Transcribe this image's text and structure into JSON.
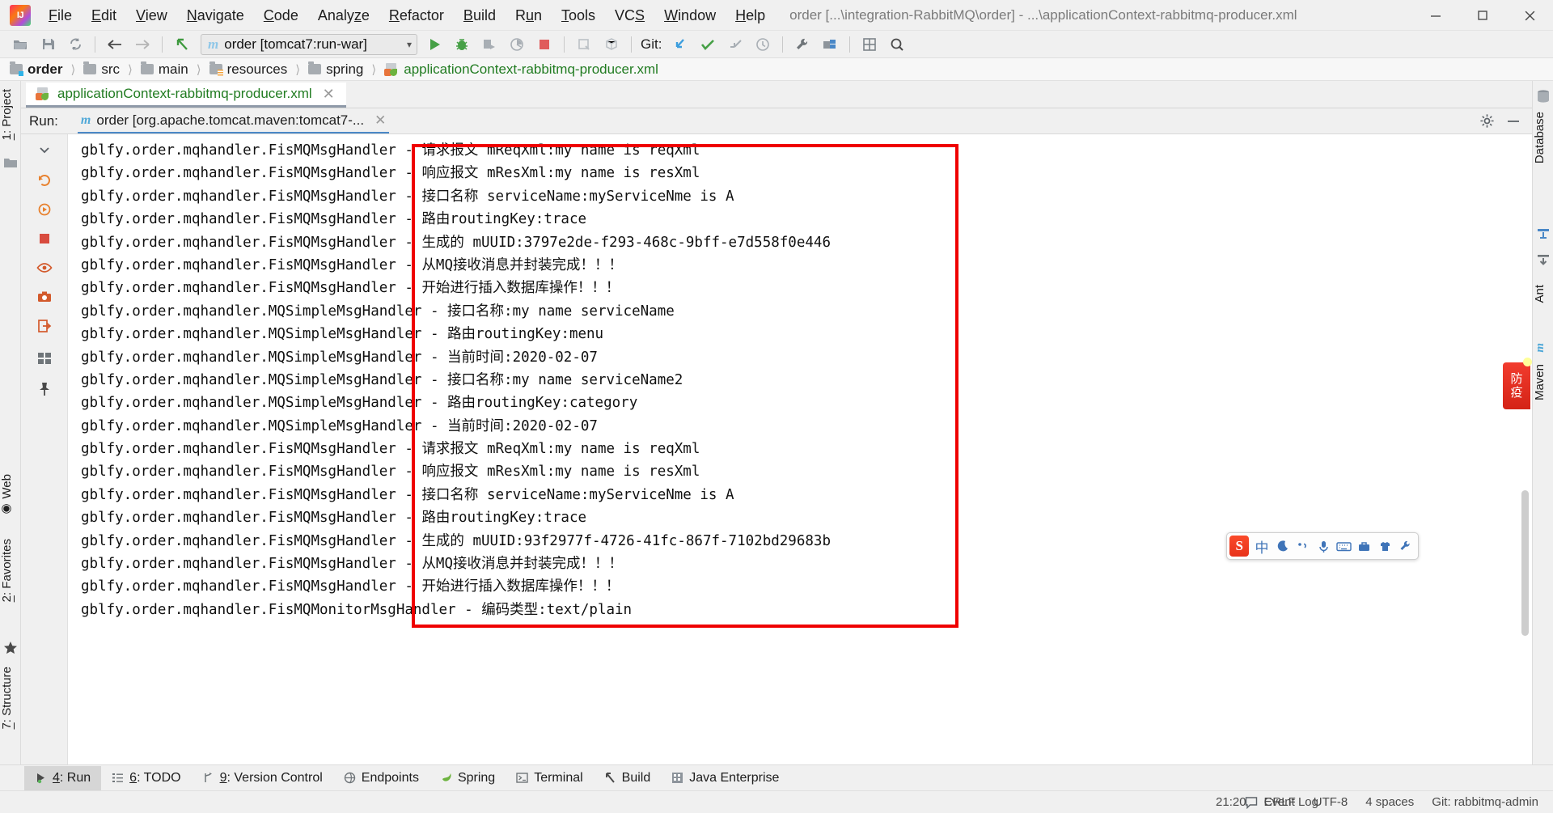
{
  "window": {
    "title": "order [...\\integration-RabbitMQ\\order] - ...\\applicationContext-rabbitmq-producer.xml",
    "app_icon": "intellij-idea-logo",
    "minimize": "—",
    "maximize": "☐",
    "close": "✕"
  },
  "menubar": {
    "items": [
      {
        "label": "File",
        "mnemonic": "F"
      },
      {
        "label": "Edit",
        "mnemonic": "E"
      },
      {
        "label": "View",
        "mnemonic": "V"
      },
      {
        "label": "Navigate",
        "mnemonic": "N"
      },
      {
        "label": "Code",
        "mnemonic": "C"
      },
      {
        "label": "Analyze",
        "mnemonic": "z"
      },
      {
        "label": "Refactor",
        "mnemonic": "R"
      },
      {
        "label": "Build",
        "mnemonic": "B"
      },
      {
        "label": "Run",
        "mnemonic": "u"
      },
      {
        "label": "Tools",
        "mnemonic": "T"
      },
      {
        "label": "VCS",
        "mnemonic": "S"
      },
      {
        "label": "Window",
        "mnemonic": "W"
      },
      {
        "label": "Help",
        "mnemonic": "H"
      }
    ]
  },
  "toolbar": {
    "open_icon": "open-folder-icon",
    "save_icon": "save-icon",
    "sync_icon": "sync-refresh-icon",
    "back_icon": "arrow-back-icon",
    "forward_icon": "arrow-forward-icon",
    "jump_icon": "jump-to-source-icon",
    "run_config": "order [tomcat7:run-war]",
    "run_config_icon": "maven-m-icon",
    "run_icon": "run-play-icon",
    "debug_icon": "debug-bug-icon",
    "coverage_icon": "run-with-coverage-icon",
    "profile_icon": "profiler-icon",
    "stop_icon": "stop-icon",
    "build_icon": "build-project-icon",
    "module_icon": "build-module-icon",
    "git_label": "Git:",
    "git_update_icon": "git-update-project-icon",
    "git_commit_icon": "git-commit-icon",
    "git_push_icon": "git-push-icon",
    "git_history_icon": "git-history-icon",
    "settings_icon": "wrench-settings-icon",
    "plugin_icon": "plugins-icon",
    "structure_icon": "structure-icon",
    "search_icon": "search-everywhere-icon"
  },
  "breadcrumb": {
    "items": [
      {
        "label": "order",
        "icon": "module-folder-icon",
        "bold": true,
        "kind": "module"
      },
      {
        "label": "src",
        "icon": "folder-icon",
        "kind": "folder"
      },
      {
        "label": "main",
        "icon": "folder-icon",
        "kind": "folder"
      },
      {
        "label": "resources",
        "icon": "resources-folder-icon",
        "kind": "resources"
      },
      {
        "label": "spring",
        "icon": "folder-icon",
        "kind": "folder"
      },
      {
        "label": "applicationContext-rabbitmq-producer.xml",
        "icon": "spring-xml-icon",
        "kind": "xmlfile"
      }
    ],
    "separator": "〉"
  },
  "editor_tab": {
    "label": "applicationContext-rabbitmq-producer.xml",
    "icon": "spring-xml-icon",
    "close": "✕"
  },
  "left_strip": {
    "project": {
      "label": "1: Project",
      "mnemonic": "1"
    },
    "web": {
      "label": "Web"
    },
    "favorites": {
      "label": "2: Favorites",
      "mnemonic": "2"
    },
    "structure": {
      "label": "7: Structure",
      "mnemonic": "7"
    }
  },
  "right_strip": {
    "database": {
      "label": "Database"
    },
    "ant": {
      "label": "Ant"
    },
    "maven": {
      "label": "Maven"
    }
  },
  "run_panel": {
    "title": "Run:",
    "tab_label": "order [org.apache.tomcat.maven:tomcat7-...",
    "tab_icon": "maven-m-icon",
    "tab_close": "✕",
    "settings_icon": "gear-icon",
    "minimize_icon": "minimize-icon",
    "tools": [
      {
        "name": "rerun-icon"
      },
      {
        "name": "rerun-failed-icon"
      },
      {
        "name": "stop-icon"
      },
      {
        "name": "toggle-visibility-icon"
      },
      {
        "name": "screenshot-camera-icon"
      },
      {
        "name": "export-icon"
      },
      {
        "name": "layout-icon"
      },
      {
        "name": "pin-icon"
      }
    ]
  },
  "console": {
    "logger_prefixes": {
      "fis": "gblfy.order.mqhandler.FisMQMsgHandler -",
      "simple": "gblfy.order.mqhandler.MQSimpleMsgHandler -",
      "monitor": "gblfy.order.mqhandler.FisMQMonitorMsgHandler -"
    },
    "lines": [
      {
        "prefix": "gblfy.order.mqhandler.FisMQMsgHandler -",
        "message": "请求报文 mReqXml:my name is reqXml"
      },
      {
        "prefix": "gblfy.order.mqhandler.FisMQMsgHandler -",
        "message": "响应报文 mResXml:my name is resXml"
      },
      {
        "prefix": "gblfy.order.mqhandler.FisMQMsgHandler -",
        "message": "接口名称 serviceName:myServiceNme is A"
      },
      {
        "prefix": "gblfy.order.mqhandler.FisMQMsgHandler -",
        "message": "路由routingKey:trace"
      },
      {
        "prefix": "gblfy.order.mqhandler.FisMQMsgHandler -",
        "message": "生成的 mUUID:3797e2de-f293-468c-9bff-e7d558f0e446"
      },
      {
        "prefix": "gblfy.order.mqhandler.FisMQMsgHandler -",
        "message": "从MQ接收消息并封装完成！！！"
      },
      {
        "prefix": "gblfy.order.mqhandler.FisMQMsgHandler -",
        "message": "开始进行插入数据库操作！！！"
      },
      {
        "prefix": "gblfy.order.mqhandler.MQSimpleMsgHandler -",
        "message": "接口名称:my name serviceName"
      },
      {
        "prefix": "gblfy.order.mqhandler.MQSimpleMsgHandler -",
        "message": "路由routingKey:menu"
      },
      {
        "prefix": "gblfy.order.mqhandler.MQSimpleMsgHandler -",
        "message": "当前时间:2020-02-07"
      },
      {
        "prefix": "gblfy.order.mqhandler.MQSimpleMsgHandler -",
        "message": "接口名称:my name serviceName2"
      },
      {
        "prefix": "gblfy.order.mqhandler.MQSimpleMsgHandler -",
        "message": "路由routingKey:category"
      },
      {
        "prefix": "gblfy.order.mqhandler.MQSimpleMsgHandler -",
        "message": "当前时间:2020-02-07"
      },
      {
        "prefix": "gblfy.order.mqhandler.FisMQMsgHandler -",
        "message": "请求报文 mReqXml:my name is reqXml"
      },
      {
        "prefix": "gblfy.order.mqhandler.FisMQMsgHandler -",
        "message": "响应报文 mResXml:my name is resXml"
      },
      {
        "prefix": "gblfy.order.mqhandler.FisMQMsgHandler -",
        "message": "接口名称 serviceName:myServiceNme is A"
      },
      {
        "prefix": "gblfy.order.mqhandler.FisMQMsgHandler -",
        "message": "路由routingKey:trace"
      },
      {
        "prefix": "gblfy.order.mqhandler.FisMQMsgHandler -",
        "message": "生成的 mUUID:93f2977f-4726-41fc-867f-7102bd29683b"
      },
      {
        "prefix": "gblfy.order.mqhandler.FisMQMsgHandler -",
        "message": "从MQ接收消息并封装完成！！！"
      },
      {
        "prefix": "gblfy.order.mqhandler.FisMQMsgHandler -",
        "message": "开始进行插入数据库操作！！！"
      },
      {
        "prefix": "gblfy.order.mqhandler.FisMQMonitorMsgHandler -",
        "message": "编码类型:text/plain"
      }
    ],
    "annotation": {
      "name": "red-highlight-rectangle",
      "color": "#ef0000"
    }
  },
  "bottom_bar": {
    "items": [
      {
        "label": "4: Run",
        "mnemonic": "4",
        "icon": "run-play-icon",
        "active": true
      },
      {
        "label": "6: TODO",
        "mnemonic": "6",
        "icon": "todo-list-icon",
        "active": false
      },
      {
        "label": "9: Version Control",
        "mnemonic": "9",
        "icon": "version-control-branch-icon",
        "active": false
      },
      {
        "label": "Endpoints",
        "icon": "endpoints-globe-icon",
        "active": false
      },
      {
        "label": "Spring",
        "icon": "spring-leaf-icon",
        "active": false
      },
      {
        "label": "Terminal",
        "icon": "terminal-icon",
        "active": false
      },
      {
        "label": "Build",
        "icon": "build-hammer-icon",
        "active": false
      },
      {
        "label": "Java Enterprise",
        "icon": "java-enterprise-icon",
        "active": false
      }
    ]
  },
  "status_bar": {
    "event_log": "Event Log",
    "event_log_icon": "balloon-icon",
    "position": "21:20",
    "line_separator": "CRLF",
    "encoding": "UTF-8",
    "indent": "4 spaces",
    "branch": "Git: rabbitmq-admin",
    "branch_icon": "git-branch-icon"
  },
  "ime_bar": {
    "logo": "S",
    "items": [
      {
        "label": "中",
        "name": "chinese-mode-toggle"
      },
      {
        "label": "☽",
        "name": "moon-icon"
      },
      {
        "label": "˚,",
        "name": "punctuation-icon"
      },
      {
        "label": "⬤",
        "name": "microphone-icon"
      },
      {
        "label": "⌨",
        "name": "keyboard-icon"
      },
      {
        "label": "▣",
        "name": "toolbox-icon"
      },
      {
        "label": "▼",
        "name": "skin-icon"
      },
      {
        "label": "⚙",
        "name": "settings-icon"
      }
    ]
  },
  "side_badge": {
    "line1": "防",
    "line2": "疫"
  }
}
